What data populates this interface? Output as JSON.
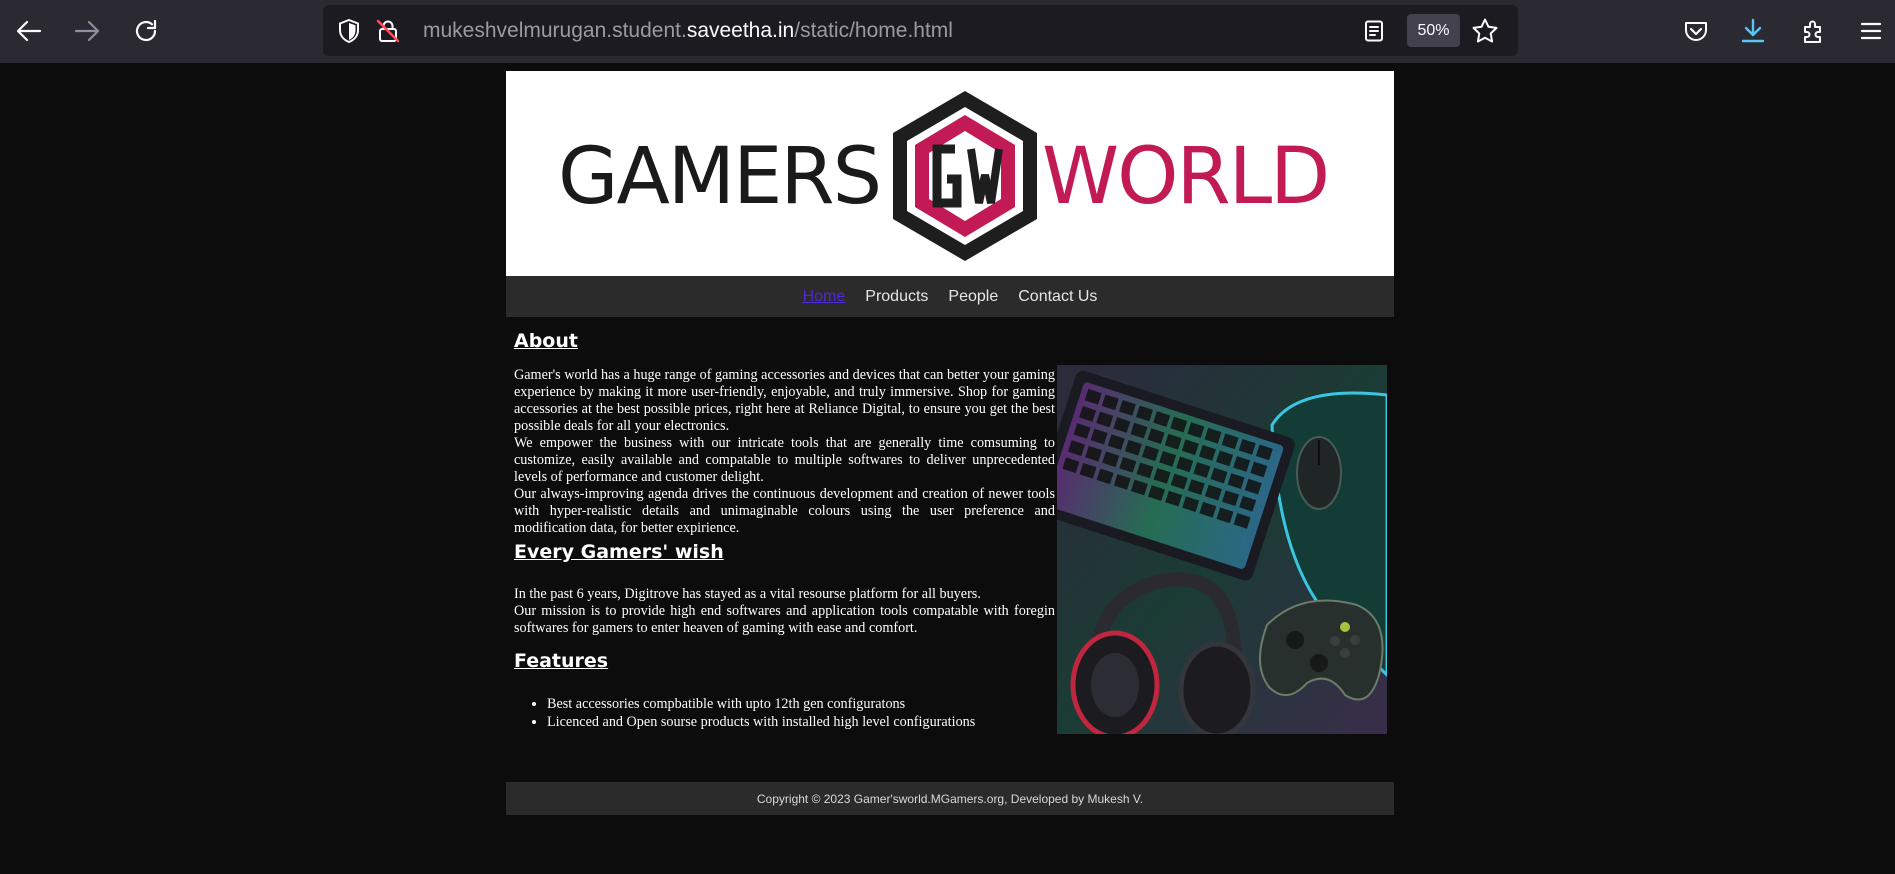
{
  "browser": {
    "url_prefix": "mukeshvelmurugan.student.",
    "url_domain": "saveetha.in",
    "url_path": "/static/home.html",
    "zoom": "50%"
  },
  "banner": {
    "word_left": "GAMERS",
    "logo_letters": "GW",
    "word_right": "WORLD",
    "colors": {
      "dark": "#1a1a1a",
      "accent": "#c21a55"
    }
  },
  "nav": {
    "items": [
      {
        "label": "Home",
        "current": true
      },
      {
        "label": "Products"
      },
      {
        "label": "People"
      },
      {
        "label": "Contact Us"
      }
    ]
  },
  "about": {
    "heading": "About",
    "paragraphs": [
      "Gamer's world has a huge range of gaming accessories and devices that can better your gaming experience by making it more user-friendly, enjoyable, and truly immersive. Shop for gaming accessories at the best possible prices, right here at Reliance Digital, to ensure you get the best possible deals for all your electronics.",
      "We empower the business with our intricate tools that are generally time comsuming to customize, easily available and compatable to multiple softwares to deliver unprecedented levels of performance and customer delight.",
      "Our always-improving agenda drives the continuous development and creation of newer tools with hyper-realistic details and unimaginable colours using the user preference and modification data, for better expirience."
    ]
  },
  "wish": {
    "heading": "Every Gamers' wish",
    "paragraphs": [
      "In the past 6 years, Digitrove has stayed as a vital resourse platform for all buyers.",
      "Our mission is to provide high end softwares and application tools compatable with foregin softwares for gamers to enter heaven of gaming with ease and comfort."
    ]
  },
  "features": {
    "heading": "Features",
    "items": [
      "Best accessories compbatible with upto 12th gen configuratons",
      "Licenced and Open sourse products with installed high level configurations"
    ]
  },
  "footer": {
    "text": "Copyright © 2023 Gamer'sworld.MGamers.org, Developed by Mukesh V."
  }
}
